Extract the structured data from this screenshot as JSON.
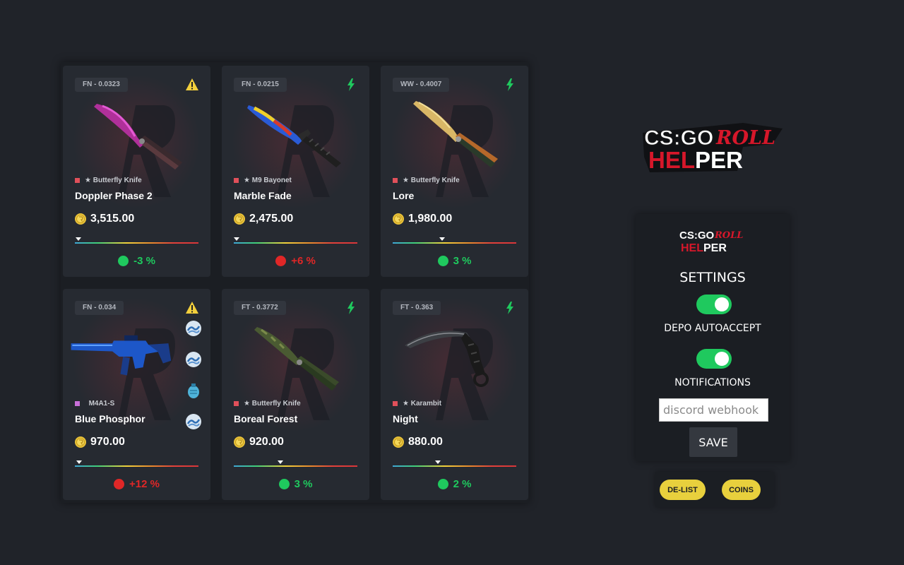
{
  "items": [
    {
      "wear": "FN - 0.0323",
      "status": "warning",
      "type_prefix": "★",
      "type": "Butterfly Knife",
      "type_color": "#e0505a",
      "name": "Doppler Phase 2",
      "price": "3,515.00",
      "float_fraction": 0.03,
      "diff": "-3 %",
      "diff_color": "#1fc95e",
      "image": "doppler-butterfly-knife"
    },
    {
      "wear": "FN - 0.0215",
      "status": "bolt",
      "type_prefix": "★",
      "type": "M9 Bayonet",
      "type_color": "#e0505a",
      "name": "Marble Fade",
      "price": "2,475.00",
      "float_fraction": 0.02,
      "diff": "+6 %",
      "diff_color": "#e02727",
      "image": "marble-fade-m9"
    },
    {
      "wear": "WW - 0.4007",
      "status": "bolt",
      "type_prefix": "★",
      "type": "Butterfly Knife",
      "type_color": "#e0505a",
      "name": "Lore",
      "price": "1,980.00",
      "float_fraction": 0.4,
      "diff": "3 %",
      "diff_color": "#1fc95e",
      "image": "lore-butterfly-knife"
    },
    {
      "wear": "FN - 0.034",
      "status": "warning",
      "type_prefix": "",
      "type": "M4A1-S",
      "type_color": "#c86fd8",
      "name": "Blue Phosphor",
      "price": "970.00",
      "float_fraction": 0.034,
      "diff": "+12 %",
      "diff_color": "#e02727",
      "image": "blue-phosphor-m4a1s",
      "stickers": [
        "wave-sticker",
        "wave-sticker",
        "grenade-sticker",
        "wave-sticker"
      ]
    },
    {
      "wear": "FT - 0.3772",
      "status": "bolt",
      "type_prefix": "★",
      "type": "Butterfly Knife",
      "type_color": "#e0505a",
      "name": "Boreal Forest",
      "price": "920.00",
      "float_fraction": 0.377,
      "diff": "3 %",
      "diff_color": "#1fc95e",
      "image": "boreal-butterfly-knife"
    },
    {
      "wear": "FT - 0.363",
      "status": "bolt",
      "type_prefix": "★",
      "type": "Karambit",
      "type_color": "#e0505a",
      "name": "Night",
      "price": "880.00",
      "float_fraction": 0.363,
      "diff": "2 %",
      "diff_color": "#1fc95e",
      "image": "night-karambit"
    }
  ],
  "logo": {
    "line1": "CS:GO",
    "line2": "ROLL",
    "line3": "HELPER"
  },
  "settings": {
    "title": "SETTINGS",
    "toggle1_label": "DEPO AUTOACCEPT",
    "toggle1_on": true,
    "toggle2_label": "NOTIFICATIONS",
    "toggle2_on": true,
    "webhook_placeholder": "discord webhook",
    "save_label": "SAVE"
  },
  "actions": {
    "delist_label": "DE-LIST",
    "coins_label": "COINS"
  },
  "colors": {
    "accent_green": "#1fc95e",
    "accent_red": "#e02727",
    "coin_yellow": "#e8d03d",
    "page_bg": "#202329"
  }
}
